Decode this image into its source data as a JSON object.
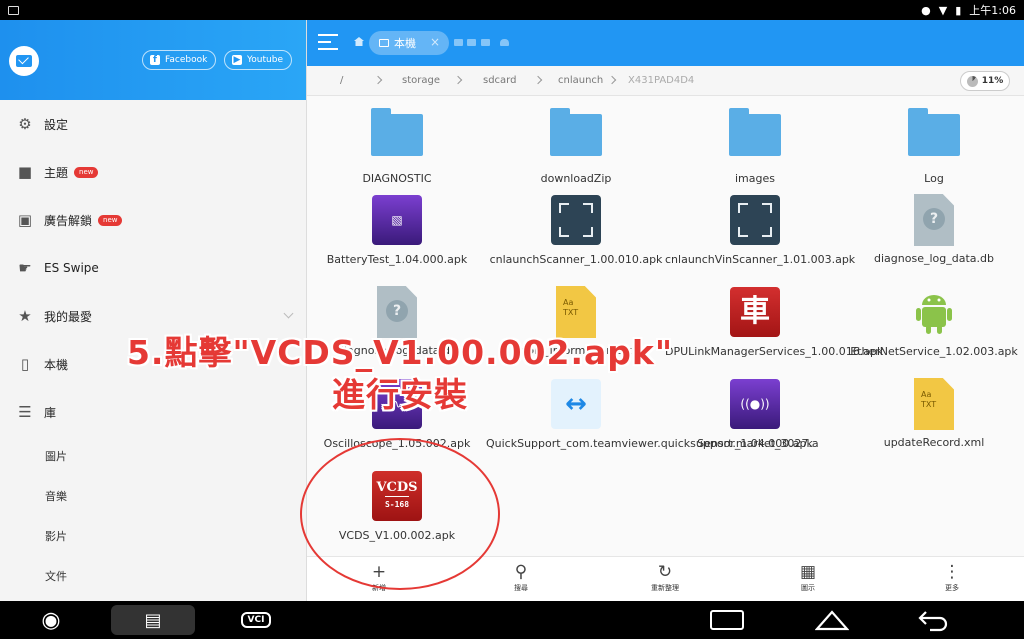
{
  "status": {
    "time": "上午1:06"
  },
  "drawer": {
    "facebook": "Facebook",
    "youtube": "Youtube",
    "items": [
      {
        "label": "設定",
        "icon": "gear-icon"
      },
      {
        "label": "主題",
        "icon": "shirt-icon",
        "badge": "new"
      },
      {
        "label": "廣告解鎖",
        "icon": "lock-icon",
        "badge": "new"
      },
      {
        "label": "ES Swipe",
        "icon": "swipe-icon"
      },
      {
        "label": "我的最愛",
        "icon": "star-icon"
      },
      {
        "label": "本機",
        "icon": "phone-icon"
      },
      {
        "label": "庫",
        "icon": "layers-icon"
      }
    ],
    "subitems": [
      "圖片",
      "音樂",
      "影片",
      "文件"
    ]
  },
  "topbar": {
    "tab_label": "本機"
  },
  "path": {
    "crumbs": [
      "/",
      "storage",
      "sdcard",
      "cnlaunch",
      "X431PAD4D4"
    ],
    "usage": "11%"
  },
  "files": [
    {
      "name": "DIAGNOSTIC",
      "kind": "folder"
    },
    {
      "name": "downloadZip",
      "kind": "folder"
    },
    {
      "name": "images",
      "kind": "folder"
    },
    {
      "name": "Log",
      "kind": "folder"
    },
    {
      "name": "BatteryTest_1.04.000.apk",
      "kind": "apk"
    },
    {
      "name": "cnlaunchScanner_1.00.010.apk",
      "kind": "apk"
    },
    {
      "name": "cnlaunchVinScanner_1.01.003.apk",
      "kind": "apk"
    },
    {
      "name": "diagnose_log_data.db",
      "kind": "unknown"
    },
    {
      "name": "diagnose_log_data.db",
      "kind": "unknown"
    },
    {
      "name": "dbin_information.txt",
      "kind": "txt"
    },
    {
      "name": "DPULinkManagerServices_1.00.016.apk",
      "kind": "apk"
    },
    {
      "name": "EtherNetService_1.02.003.apk",
      "kind": "apk"
    },
    {
      "name": "Oscilloscope_1.05.002.apk",
      "kind": "apk"
    },
    {
      "name": "QuickSupport_com.teamviewer.quicksupport.market_3027.a",
      "kind": "apk"
    },
    {
      "name": "Sensor_1.04.000.apk",
      "kind": "apk"
    },
    {
      "name": "updateRecord.xml",
      "kind": "txt"
    },
    {
      "name": "VCDS_V1.00.002.apk",
      "kind": "apk"
    }
  ],
  "icon_labels": {
    "txt": "Aa\nTXT",
    "vcds_top": "VCDS",
    "vcds_bottom": "S-168",
    "car": "車"
  },
  "toolbar": [
    "新增",
    "搜尋",
    "重新整理",
    "圖示",
    "更多"
  ],
  "overlay": {
    "line1": "5.點擊\"VCDS_V1.00.002.apk\"",
    "line2": "進行安裝"
  },
  "nav": {
    "vci": "VCI"
  },
  "colors": {
    "accent": "#2196f3",
    "annotation": "#e53935"
  }
}
